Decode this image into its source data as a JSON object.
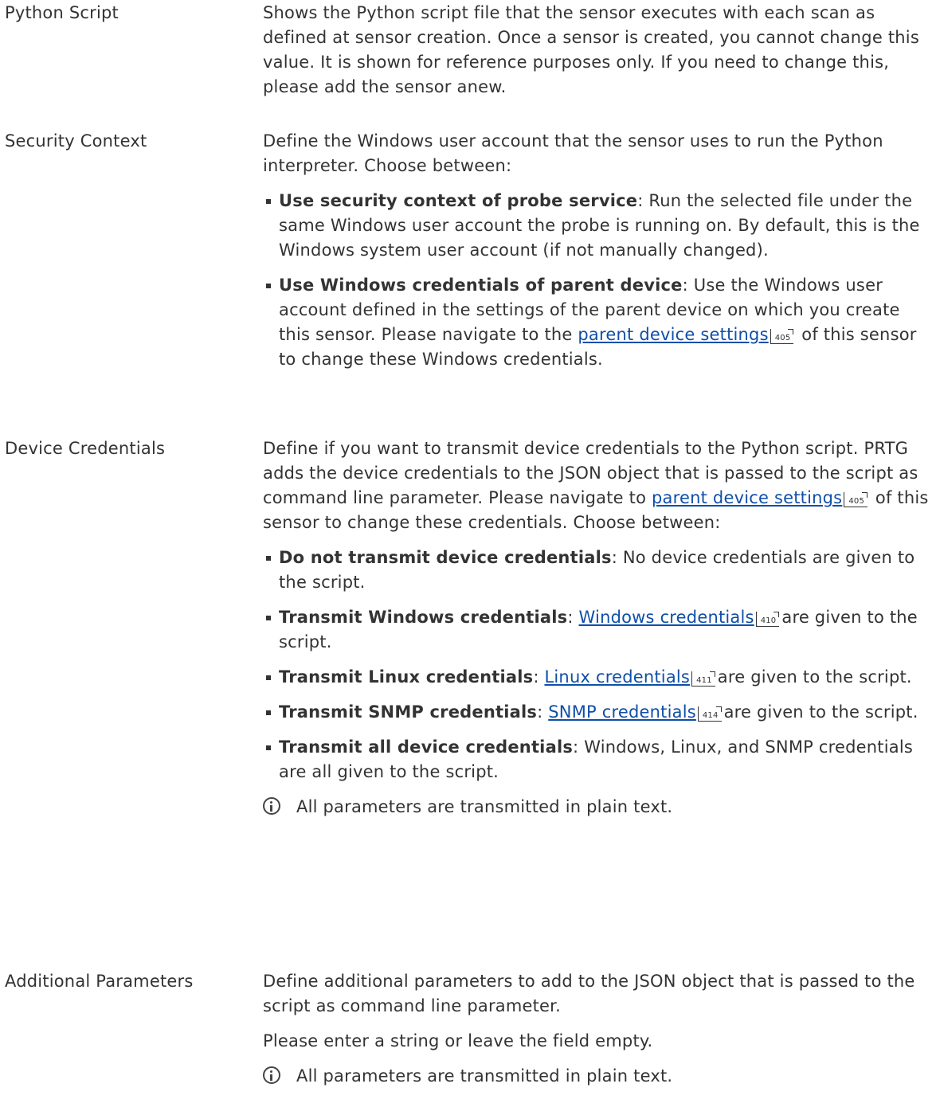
{
  "python_script": {
    "label": "Python Script",
    "text": "Shows the Python script file that the sensor executes with each scan as defined at sensor creation. Once a sensor is created, you cannot change this value. It is shown for reference purposes only. If you need to change this, please add the sensor anew."
  },
  "security_context": {
    "label": "Security Context",
    "intro": "Define the Windows user account that the sensor uses to run the Python interpreter. Choose between:",
    "opt1_term": "Use security context of probe service",
    "opt1_text": ": Run the selected file under the same Windows user account the probe is running on. By default, this is the Windows system user account (if not manually changed).",
    "opt2_term": "Use Windows credentials of parent device",
    "opt2_text1": ": Use the Windows user account defined in the settings of the parent device on which you create this sensor. Please navigate to the ",
    "opt2_link": "parent device settings",
    "opt2_ref": "405",
    "opt2_text2": " of this sensor to change these Windows credentials."
  },
  "device_credentials": {
    "label": "Device Credentials",
    "intro1": "Define if you want to transmit device credentials to the Python script. PRTG adds the device credentials to the JSON object that is passed to the script as command line parameter. Please navigate to ",
    "intro_link": "parent device settings",
    "intro_ref": "405",
    "intro2": " of this sensor to change these credentials. Choose between:",
    "opt1_term": "Do not transmit device credentials",
    "opt1_text": ": No device credentials are given to the script.",
    "opt2_term": "Transmit Windows credentials",
    "opt2_sep": ": ",
    "opt2_link": "Windows credentials",
    "opt2_ref": "410",
    "opt2_text": "are given to the script.",
    "opt3_term": "Transmit Linux credentials",
    "opt3_sep": ": ",
    "opt3_link": "Linux credentials",
    "opt3_ref": "411",
    "opt3_text": "are given to the script.",
    "opt4_term": "Transmit SNMP credentials",
    "opt4_sep": ": ",
    "opt4_link": "SNMP credentials",
    "opt4_ref": "414",
    "opt4_text": "are given to the script.",
    "opt5_term": "Transmit all device credentials",
    "opt5_text": ": Windows, Linux, and SNMP credentials are all given to the script.",
    "note": "All parameters are transmitted in plain text."
  },
  "additional_parameters": {
    "label": "Additional Parameters",
    "text": "Define additional parameters to add to the JSON object that is passed to the script as command line parameter.",
    "hint": "Please enter a string or leave the field empty.",
    "note": "All parameters are transmitted in plain text."
  }
}
